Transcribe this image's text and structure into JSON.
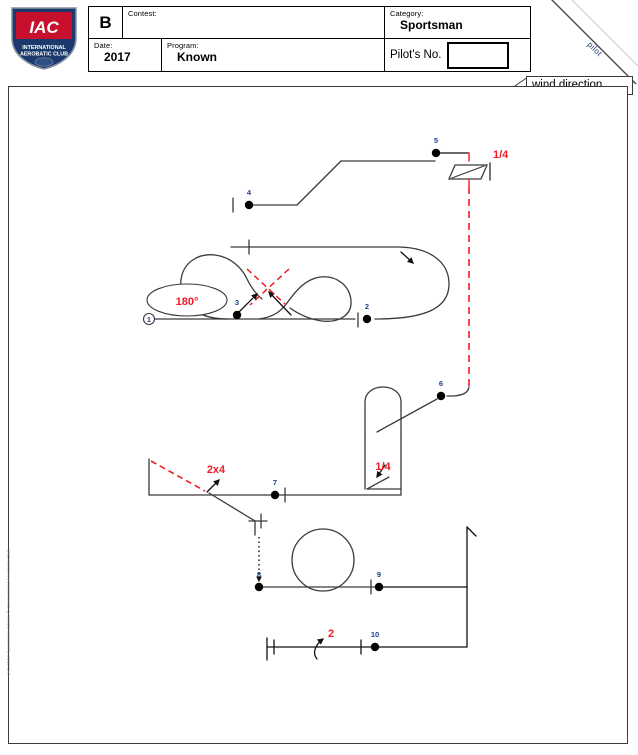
{
  "header": {
    "sequence_letter": "B",
    "contest_label": "Contest:",
    "contest_value": "",
    "category_label": "Category:",
    "category_value": "Sportsman",
    "date_label": "Date:",
    "date_value": "2017",
    "program_label": "Program:",
    "program_value": "Known",
    "pilot_no_label": "Pilot's No.",
    "pilot_no_value": ""
  },
  "logo": {
    "main_text": "IAC",
    "line1": "INTERNATIONAL",
    "line2": "AEROBATIC CLUB",
    "shield_red": "#c8102e",
    "shield_navy": "#1b3a6b"
  },
  "wind": {
    "label": "wind direction",
    "axis_label": "pilot"
  },
  "watermark": {
    "text": "IAC 2017 Sportsman Known  © International Aerobatic Club"
  },
  "sequence": {
    "title": "Sportsman Known B 2017",
    "start_marker": "1",
    "figures": [
      {
        "num": "1",
        "name": "start-entry-line",
        "label": ""
      },
      {
        "num": "2",
        "name": "horizontal-eight",
        "label": ""
      },
      {
        "num": "3",
        "name": "half-loop-turnaround",
        "label": "180°"
      },
      {
        "num": "4",
        "name": "forty-five-up-line",
        "label": ""
      },
      {
        "num": "5",
        "name": "quarter-roll-vertical",
        "label": "1/4"
      },
      {
        "num": "6",
        "name": "hammerhead-quarter-roll",
        "label": "1/4"
      },
      {
        "num": "7",
        "name": "two-of-four-point-roll",
        "label": "2x4"
      },
      {
        "num": "8",
        "name": "loop",
        "label": ""
      },
      {
        "num": "9",
        "name": "vertical-up-line",
        "label": ""
      },
      {
        "num": "10",
        "name": "two-turn-spin",
        "label": "2"
      }
    ],
    "annotations": {
      "turnaround_180": "180°",
      "quarter_roll_top": "1/4",
      "quarter_roll_mid": "1/4",
      "two_by_four_roll": "2x4",
      "spin_turns": "2"
    },
    "colors": {
      "line": "#3a3a3a",
      "roll_red": "#ee1c25",
      "number_blue": "#1c3f94",
      "point_dot": "#000000"
    }
  }
}
